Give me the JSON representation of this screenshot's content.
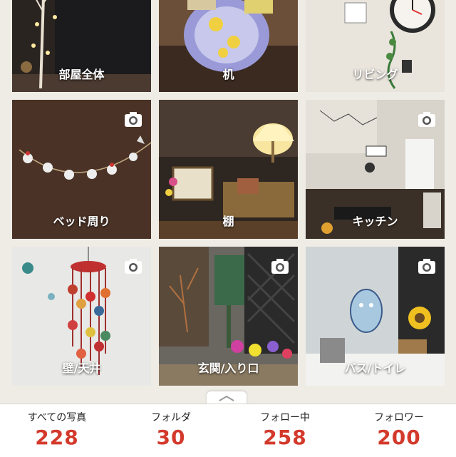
{
  "folders": [
    {
      "label": "部屋全体",
      "camera": false
    },
    {
      "label": "机",
      "camera": false
    },
    {
      "label": "リビング",
      "camera": false
    },
    {
      "label": "ベッド周り",
      "camera": true
    },
    {
      "label": "棚",
      "camera": false
    },
    {
      "label": "キッチン",
      "camera": true
    },
    {
      "label": "壁/天井",
      "camera": true
    },
    {
      "label": "玄関/入り口",
      "camera": true
    },
    {
      "label": "バス/トイレ",
      "camera": true
    }
  ],
  "stats": [
    {
      "title": "すべての写真",
      "value": "228"
    },
    {
      "title": "フォルダ",
      "value": "30"
    },
    {
      "title": "フォロー中",
      "value": "258"
    },
    {
      "title": "フォロワー",
      "value": "200"
    }
  ],
  "icons": {
    "camera": "camera-icon",
    "handle": "chevron-up-icon"
  },
  "colors": {
    "stat_value": "#d33a2c",
    "background": "#efece6"
  }
}
